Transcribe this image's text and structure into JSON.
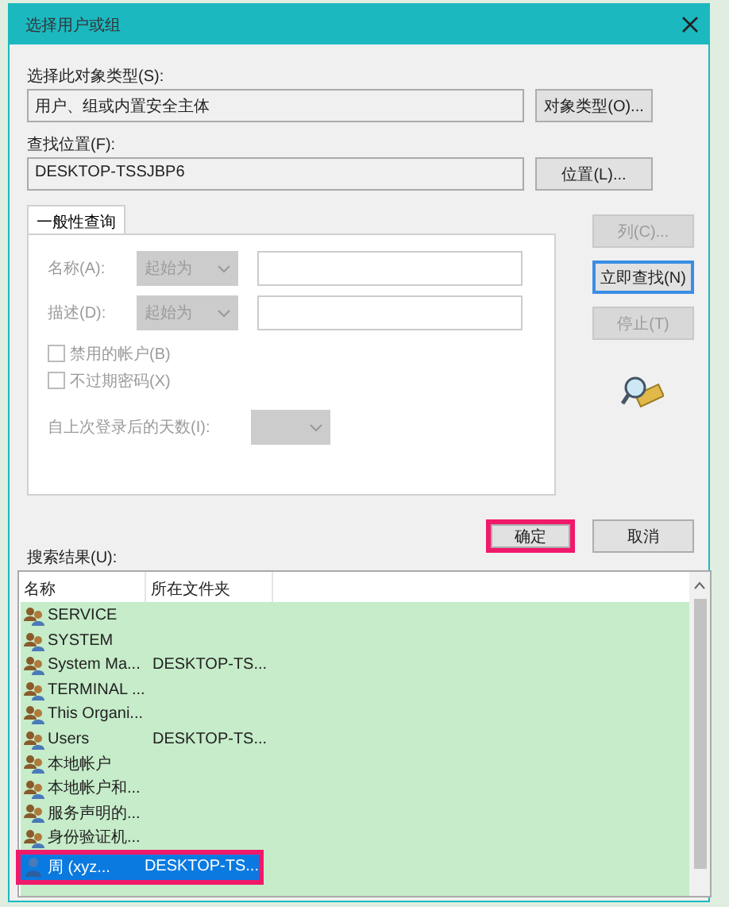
{
  "window": {
    "title": "选择用户或组"
  },
  "object_type": {
    "label": "选择此对象类型(S):",
    "value": "用户、组或内置安全主体",
    "button": "对象类型(O)..."
  },
  "location": {
    "label": "查找位置(F):",
    "value": "DESKTOP-TSSJBP6",
    "button": "位置(L)..."
  },
  "tabs": [
    {
      "label": "一般性查询",
      "selected": true
    }
  ],
  "query": {
    "disabled": true,
    "fields": [
      {
        "label": "名称(A):",
        "combo": "起始为"
      },
      {
        "label": "描述(D):",
        "combo": "起始为"
      }
    ],
    "checkboxes": [
      {
        "label": "禁用的帐户(B)",
        "checked": false
      },
      {
        "label": "不过期密码(X)",
        "checked": false
      }
    ],
    "days_label": "自上次登录后的天数(I):"
  },
  "side_buttons": [
    {
      "label": "列(C)...",
      "disabled": true
    },
    {
      "label": "立即查找(N)",
      "disabled": false
    },
    {
      "label": "停止(T)",
      "disabled": true
    }
  ],
  "dialog_buttons": [
    {
      "label": "确定",
      "highlighted": true
    },
    {
      "label": "取消",
      "highlighted": false
    }
  ],
  "results": {
    "label": "搜索结果(U):",
    "columns": [
      "名称",
      "所在文件夹"
    ],
    "rows": [
      {
        "kind": "group",
        "name": "SERVICE",
        "folder": "",
        "selected": false
      },
      {
        "kind": "group",
        "name": "SYSTEM",
        "folder": "",
        "selected": false
      },
      {
        "kind": "group",
        "name": "System Ma...",
        "folder": "DESKTOP-TS...",
        "selected": false
      },
      {
        "kind": "group",
        "name": "TERMINAL ...",
        "folder": "",
        "selected": false
      },
      {
        "kind": "group",
        "name": "This Organi...",
        "folder": "",
        "selected": false
      },
      {
        "kind": "group",
        "name": "Users",
        "folder": "DESKTOP-TS...",
        "selected": false
      },
      {
        "kind": "group",
        "name": "本地帐户",
        "folder": "",
        "selected": false
      },
      {
        "kind": "group",
        "name": "本地帐户和...",
        "folder": "",
        "selected": false
      },
      {
        "kind": "group",
        "name": "服务声明的...",
        "folder": "",
        "selected": false
      },
      {
        "kind": "group",
        "name": "身份验证机...",
        "folder": "",
        "selected": false
      },
      {
        "kind": "user",
        "name": "周 (xyz...",
        "folder": "DESKTOP-TS...",
        "selected": true
      }
    ]
  }
}
